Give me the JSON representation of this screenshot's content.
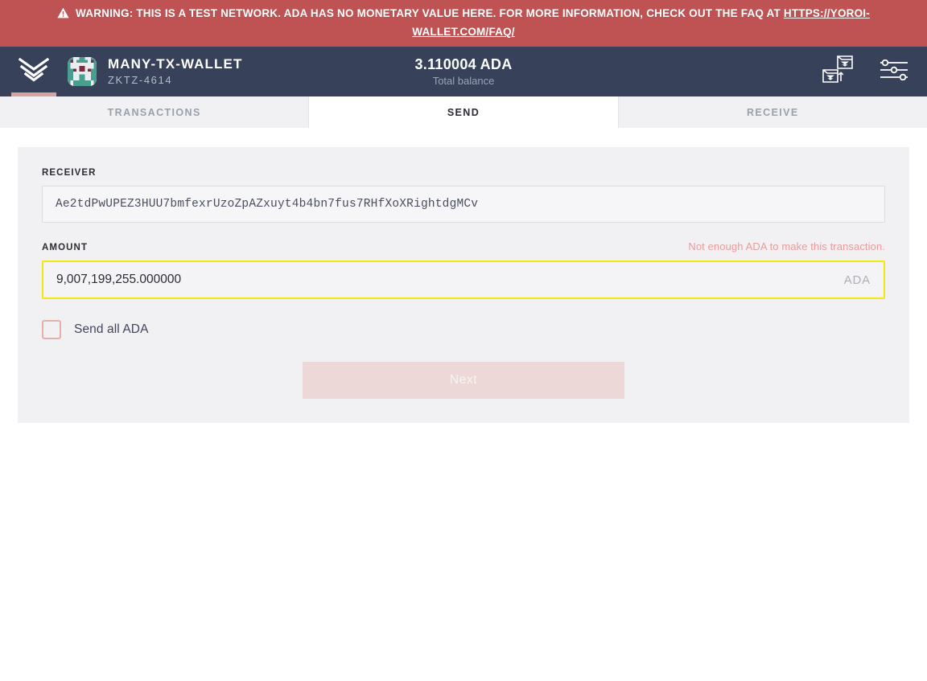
{
  "warning": {
    "icon": "warning-triangle-icon",
    "text_before": "WARNING: THIS IS A TEST NETWORK. ADA HAS NO MONETARY VALUE HERE. FOR MORE INFORMATION, CHECK OUT THE FAQ AT ",
    "link_text": "HTTPS://YOROI-WALLET.COM/FAQ/",
    "background_color": "#bf5353",
    "text_color": "#ffffff"
  },
  "topbar": {
    "logo_icon": "yoroi-chevrons-logo-icon",
    "avatar_icon": "wallet-identicon-avatar",
    "wallet_name": "MANY-TX-WALLET",
    "wallet_plate": "ZKTZ-4614",
    "balance_amount": "3.110004 ADA",
    "balance_label": "Total balance",
    "switch_wallet_icon": "switch-wallet-icon",
    "settings_icon": "sliders-settings-icon",
    "background_color": "#38415a",
    "accent_color": "#d9a0a0"
  },
  "tabs": [
    {
      "label": "TRANSACTIONS",
      "active": false
    },
    {
      "label": "SEND",
      "active": true
    },
    {
      "label": "RECEIVE",
      "active": false
    }
  ],
  "form": {
    "receiver": {
      "label": "RECEIVER",
      "value": "Ae2tdPwUPEZ3HUU7bmfexrUzoZpAZxuyt4b4bn7fus7RHfXoXRightdgMCv",
      "placeholder": "Receiver"
    },
    "amount": {
      "label": "AMOUNT",
      "value": "9,007,199,255.000000",
      "unit": "ADA",
      "placeholder": "0.000000",
      "error": "Not enough ADA to make this transaction.",
      "error_color": "#eb9a9a",
      "focus_border_color": "#f2e80a"
    },
    "send_all": {
      "label": "Send all ADA",
      "checked": false,
      "checkbox_border_color": "#e4b0ab"
    },
    "next_button": {
      "label": "Next",
      "disabled": true,
      "background_color": "#ecd9d7"
    }
  }
}
